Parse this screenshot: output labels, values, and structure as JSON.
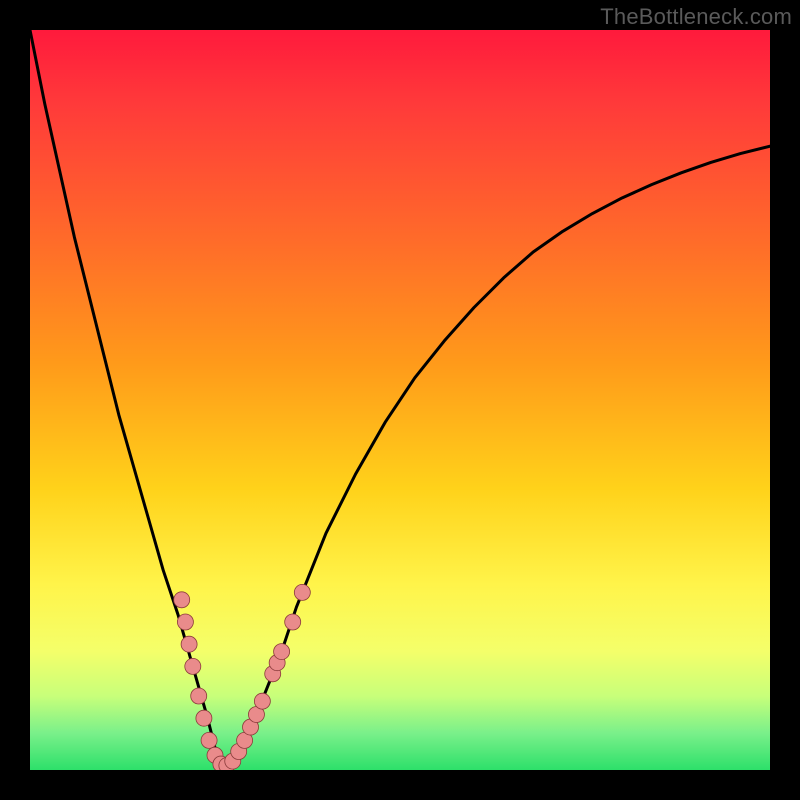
{
  "watermark": {
    "text": "TheBottleneck.com"
  },
  "colors": {
    "curve_stroke": "#000000",
    "marker_fill": "#e98b8b",
    "marker_stroke": "#8a3a3a",
    "gradient_top": "#ff1a3c",
    "gradient_bottom": "#2de06a"
  },
  "chart_data": {
    "type": "line",
    "title": "",
    "xlabel": "",
    "ylabel": "",
    "xlim": [
      0,
      100
    ],
    "ylim": [
      0,
      100
    ],
    "grid": false,
    "legend": false,
    "description": "V-shaped bottleneck curve on a red-to-green vertical gradient. Minimum (nadir) near x≈26, y≈0. Left branch rises steeply to ~y=100 at x≈0; right branch rises and levels off near y≈85 at x=100.",
    "x": [
      0,
      2,
      4,
      6,
      8,
      10,
      12,
      14,
      16,
      18,
      20,
      22,
      24,
      25,
      26,
      27,
      28,
      30,
      32,
      34,
      36,
      38,
      40,
      44,
      48,
      52,
      56,
      60,
      64,
      68,
      72,
      76,
      80,
      84,
      88,
      92,
      96,
      100
    ],
    "values": [
      100,
      90,
      81,
      72,
      64,
      56,
      48,
      41,
      34,
      27,
      21,
      14,
      7,
      3,
      0.5,
      1,
      2.5,
      6,
      11,
      16,
      22,
      27,
      32,
      40,
      47,
      53,
      58,
      62.5,
      66.5,
      70,
      72.8,
      75.2,
      77.3,
      79.1,
      80.7,
      82.1,
      83.3,
      84.3
    ],
    "markers": [
      {
        "x": 20.5,
        "y": 23
      },
      {
        "x": 21.0,
        "y": 20
      },
      {
        "x": 21.5,
        "y": 17
      },
      {
        "x": 22.0,
        "y": 14
      },
      {
        "x": 22.8,
        "y": 10
      },
      {
        "x": 23.5,
        "y": 7
      },
      {
        "x": 24.2,
        "y": 4
      },
      {
        "x": 25.0,
        "y": 2
      },
      {
        "x": 25.8,
        "y": 0.8
      },
      {
        "x": 26.6,
        "y": 0.6
      },
      {
        "x": 27.4,
        "y": 1.2
      },
      {
        "x": 28.2,
        "y": 2.5
      },
      {
        "x": 29.0,
        "y": 4
      },
      {
        "x": 29.8,
        "y": 5.8
      },
      {
        "x": 30.6,
        "y": 7.5
      },
      {
        "x": 31.4,
        "y": 9.3
      },
      {
        "x": 32.8,
        "y": 13
      },
      {
        "x": 33.4,
        "y": 14.5
      },
      {
        "x": 34.0,
        "y": 16
      },
      {
        "x": 35.5,
        "y": 20
      },
      {
        "x": 36.8,
        "y": 24
      }
    ]
  }
}
